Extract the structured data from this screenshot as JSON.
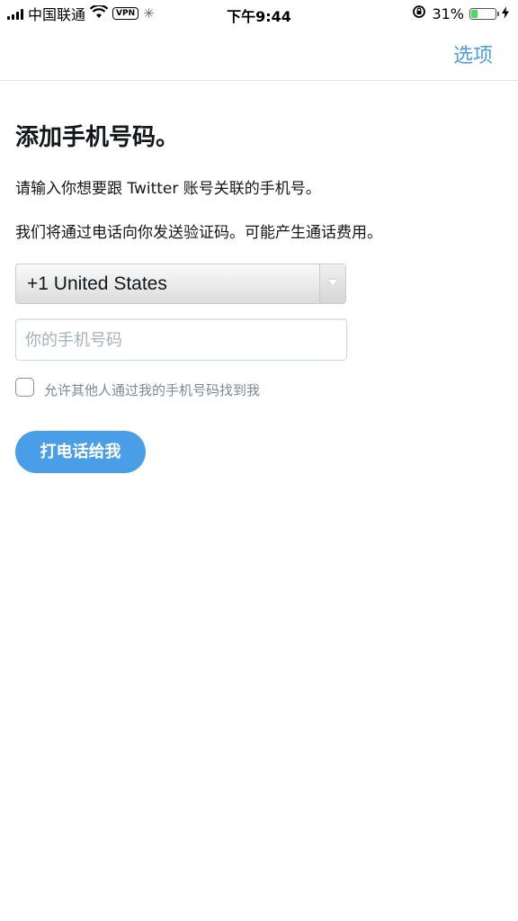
{
  "status_bar": {
    "carrier": "中国联通",
    "vpn_label": "VPN",
    "time": "下午9:44",
    "battery_percent": "31%",
    "battery_level": 0.31
  },
  "nav": {
    "options_label": "选项"
  },
  "main": {
    "title": "添加手机号码。",
    "description": "请输入你想要跟 Twitter 账号关联的手机号。",
    "call_notice": "我们将通过电话向你发送验证码。可能产生通话费用。",
    "country_select": "+1 United States",
    "phone_placeholder": "你的手机号码",
    "discoverable_label": "允许其他人通过我的手机号码找到我",
    "call_button": "打电话给我"
  },
  "colors": {
    "accent": "#4a9ee8",
    "text": "#14171a",
    "muted": "#7c8a96",
    "battery": "#4cd964"
  }
}
